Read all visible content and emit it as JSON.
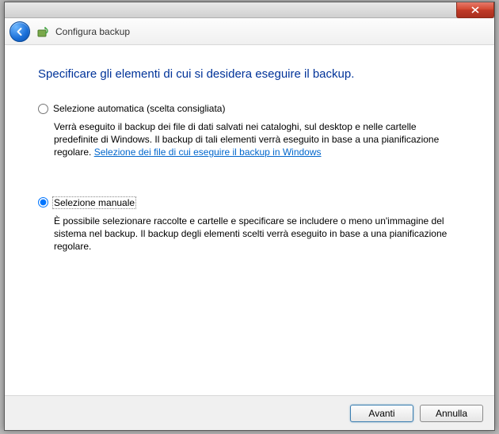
{
  "header": {
    "title": "Configura backup"
  },
  "heading": "Specificare gli elementi di cui si desidera eseguire il backup.",
  "options": {
    "auto": {
      "label": "Selezione automatica (scelta consigliata)",
      "desc_a": "Verrà eseguito il backup dei file di dati salvati nei cataloghi, sul desktop e nelle cartelle predefinite di Windows. Il backup di tali elementi verrà eseguito in base a una pianificazione regolare. ",
      "link": "Selezione dei file di cui eseguire il backup in Windows"
    },
    "manual": {
      "label": "Selezione manuale",
      "desc": "È possibile selezionare raccolte e cartelle e specificare se includere o meno un'immagine del sistema nel backup. Il backup degli elementi scelti verrà eseguito in base a una pianificazione regolare."
    }
  },
  "selected": "manual",
  "buttons": {
    "next": "Avanti",
    "cancel": "Annulla"
  }
}
